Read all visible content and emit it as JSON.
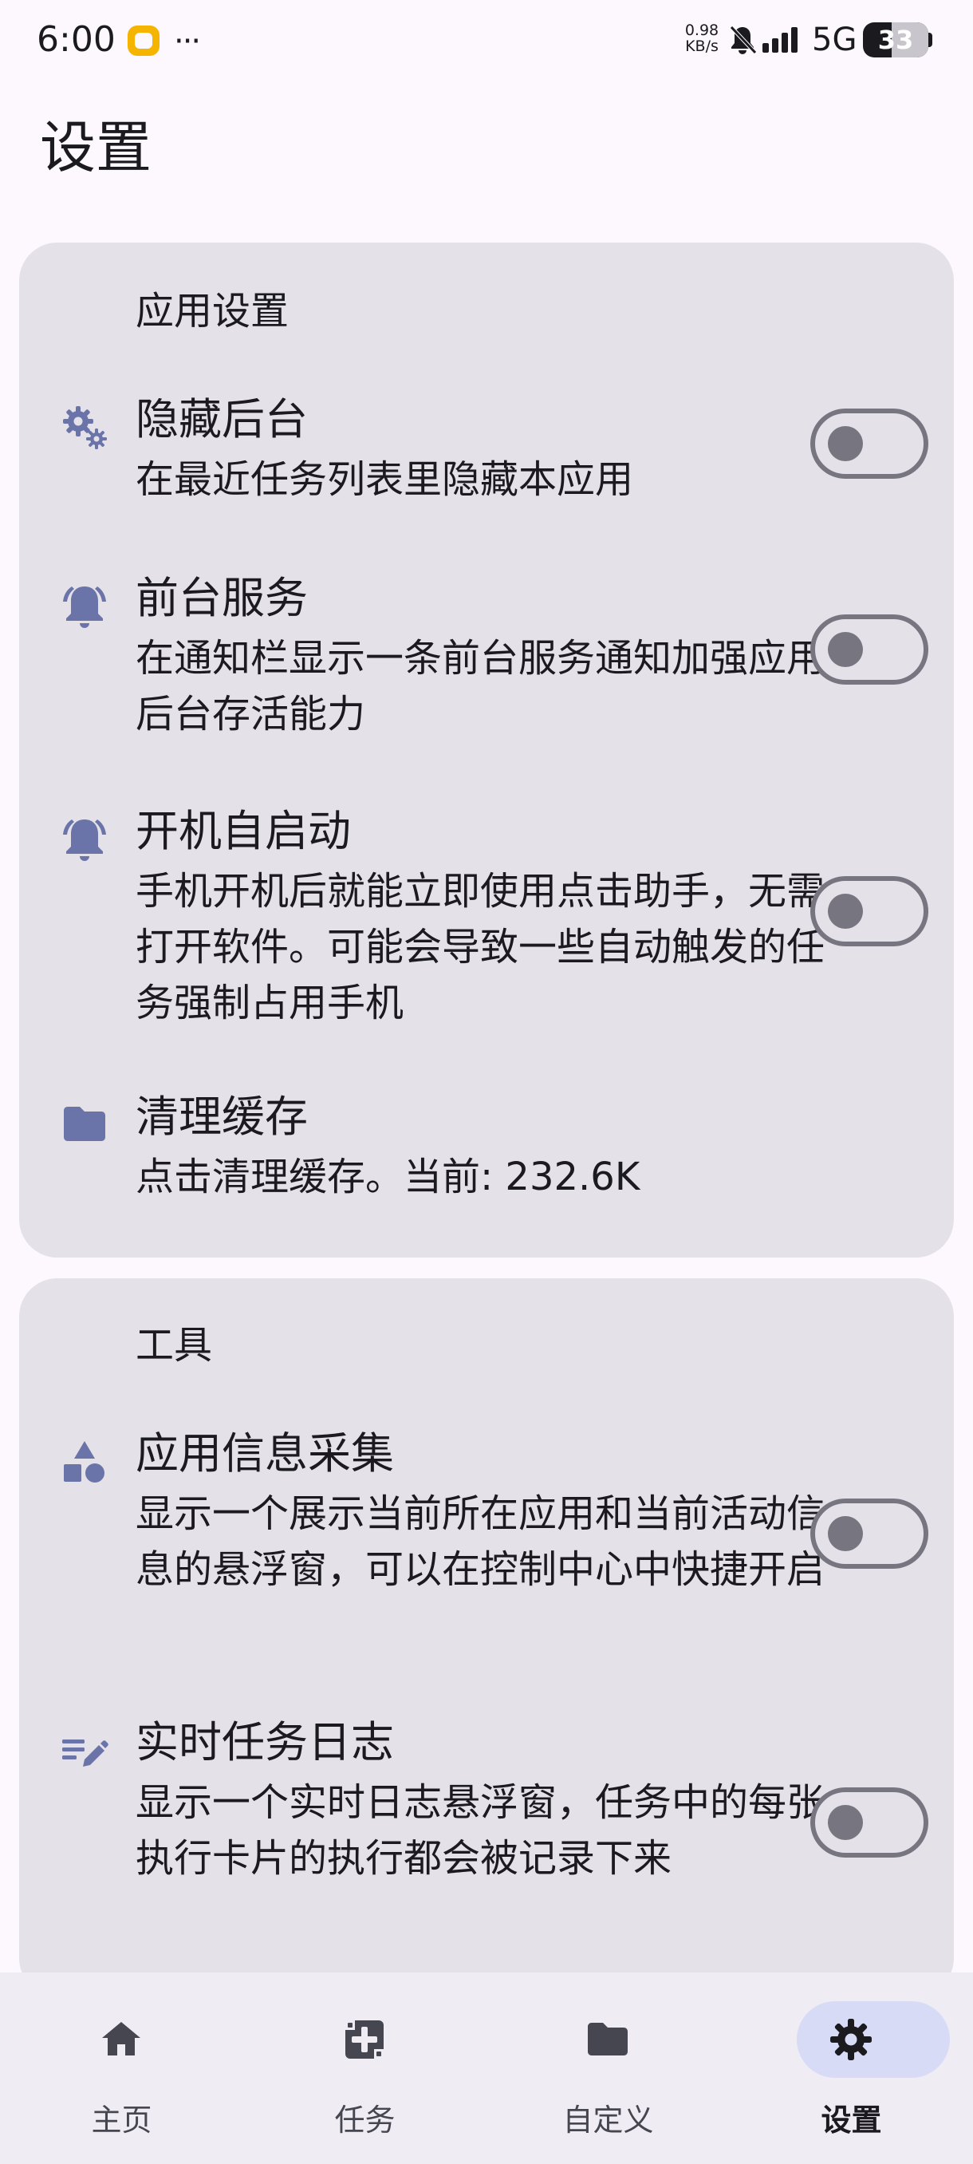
{
  "status_bar": {
    "time": "6:00",
    "more": "···",
    "speed_value": "0.98",
    "speed_unit": "KB/s",
    "network": "5G",
    "battery": "33"
  },
  "page": {
    "title": "设置"
  },
  "app_settings": {
    "title": "应用设置",
    "items": [
      {
        "title": "隐藏后台",
        "description": "在最近任务列表里隐藏本应用",
        "icon": "gears-icon",
        "toggle_on": false
      },
      {
        "title": "前台服务",
        "description": "在通知栏显示一条前台服务通知加强应用后台存活能力",
        "icon": "bell-icon",
        "toggle_on": false
      },
      {
        "title": "开机自启动",
        "description": "手机开机后就能立即使用点击助手，无需打开软件。可能会导致一些自动触发的任务强制占用手机",
        "icon": "bell-icon",
        "toggle_on": false
      },
      {
        "title": "清理缓存",
        "description": "点击清理缓存。当前: 232.6K",
        "icon": "folder-icon"
      }
    ]
  },
  "tools": {
    "title": "工具",
    "items": [
      {
        "title": "应用信息采集",
        "description": "显示一个展示当前所在应用和当前活动信息的悬浮窗，可以在控制中心中快捷开启",
        "icon": "shapes-icon",
        "toggle_on": false
      },
      {
        "title": "实时任务日志",
        "description": "显示一个实时日志悬浮窗，任务中的每张执行卡片的执行都会被记录下来",
        "icon": "edit-note-icon",
        "toggle_on": false
      }
    ]
  },
  "bottom_nav": {
    "items": [
      {
        "label": "主页",
        "icon": "home-icon"
      },
      {
        "label": "任务",
        "icon": "task-icon"
      },
      {
        "label": "自定义",
        "icon": "folder-icon"
      },
      {
        "label": "设置",
        "icon": "settings-icon",
        "active": true
      }
    ]
  },
  "colors": {
    "background": "#fcf8fd",
    "card": "#e4e1e9",
    "icon_accent": "#6b74a8",
    "nav_background": "#f0ecf4",
    "nav_active_indicator": "#d8dbf5",
    "toggle_outline": "#777680"
  }
}
